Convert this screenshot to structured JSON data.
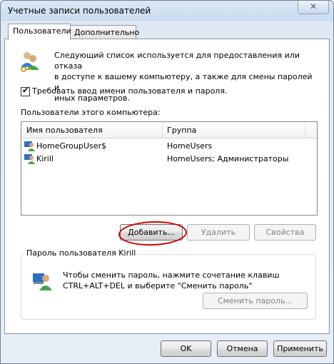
{
  "window": {
    "title": "Учетные записи пользователей",
    "close_glyph": "✕"
  },
  "tabs": [
    {
      "label": "Пользователи",
      "active": true
    },
    {
      "label": "Дополнительно",
      "active": false
    }
  ],
  "info_text_lines": [
    "Следующий список используется для предоставления или отказа",
    "в доступе к вашему компьютеру, а также для смены паролей и",
    "иных параметров."
  ],
  "require_login": {
    "label": "Требовать ввод имени пользователя и пароля.",
    "checked": true
  },
  "users_section_label": "Пользователи этого компьютера:",
  "users_table": {
    "columns": [
      "Имя пользователя",
      "Группа"
    ],
    "rows": [
      {
        "name": "HomeGroupUser$",
        "group": "HomeUsers"
      },
      {
        "name": "Kirill",
        "group": "HomeUsers; Администраторы"
      }
    ]
  },
  "list_buttons": {
    "add": "Добавить...",
    "remove": "Удалить",
    "properties": "Свойства"
  },
  "password_group": {
    "label": "Пароль пользователя Kirill",
    "text_lines": [
      "Чтобы сменить пароль, нажмите сочетание клавиш",
      "CTRL+ALT+DEL и выберите \"Сменить пароль\""
    ],
    "change_button": "Сменить пароль..."
  },
  "footer_buttons": {
    "ok": "OK",
    "cancel": "Отмена",
    "apply": "Применить"
  },
  "colors": {
    "annotation_circle": "#d20000",
    "window_frame": "#6e7f94"
  }
}
